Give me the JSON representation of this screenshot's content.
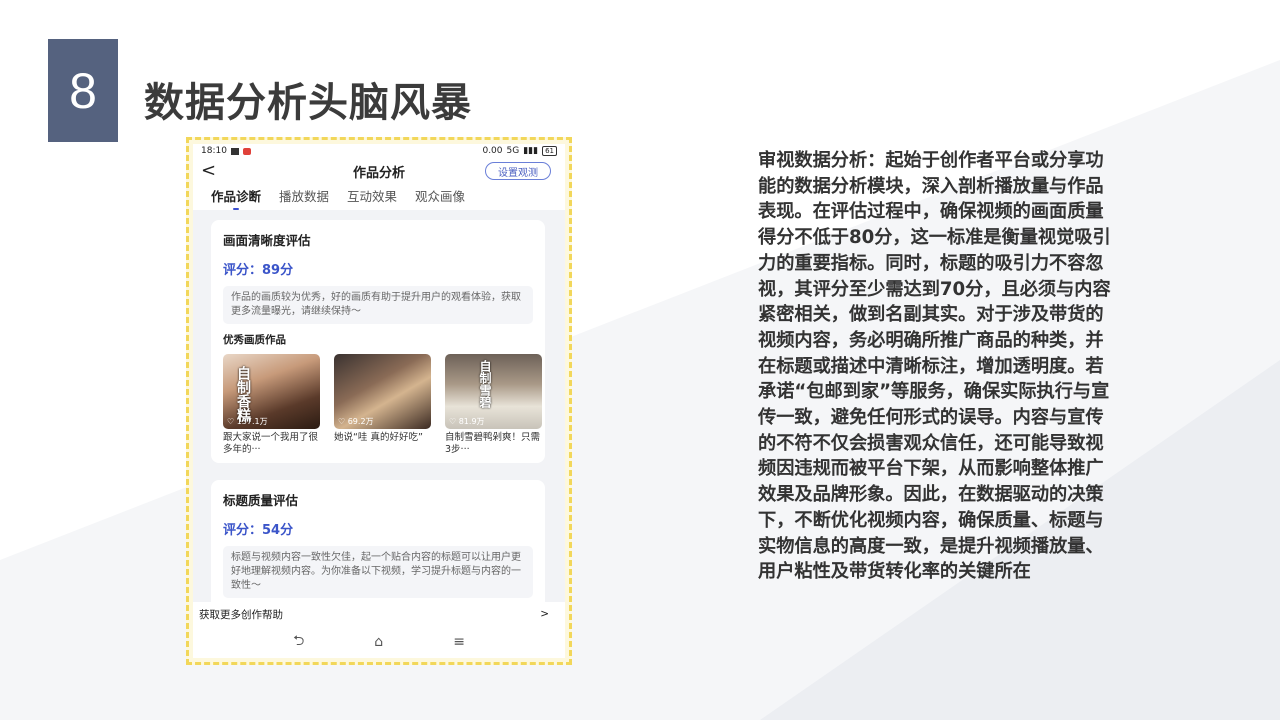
{
  "slide": {
    "number": "8",
    "title": "数据分析头脑风暴",
    "body": "审视数据分析：起始于创作者平台或分享功能的数据分析模块，深入剖析播放量与作品表现。在评估过程中，确保视频的画面质量得分不低于80分，这一标准是衡量视觉吸引力的重要指标。同时，标题的吸引力不容忽视，其评分至少需达到70分，且必须与内容紧密相关，做到名副其实。对于涉及带货的视频内容，务必明确所推广商品的种类，并在标题或描述中清晰标注，增加透明度。若承诺“包邮到家”等服务，确保实际执行与宣传一致，避免任何形式的误导。内容与宣传的不符不仅会损害观众信任，还可能导致视频因违规而被平台下架，从而影响整体推广效果及品牌形象。因此，在数据驱动的决策下，不断优化视频内容，确保质量、标题与实物信息的高度一致，是提升视频播放量、用户粘性及带货转化率的关键所在"
  },
  "phone": {
    "status": {
      "time": "18:10",
      "speed": "0.00",
      "signal": "5G",
      "battery": "61"
    },
    "nav": {
      "back": "<",
      "title": "作品分析",
      "settings_button": "设置观测"
    },
    "tabs": [
      "作品诊断",
      "播放数据",
      "互动效果",
      "观众画像"
    ],
    "quality_card": {
      "title": "画面清晰度评估",
      "score": "评分：89分",
      "desc": "作品的画质较为优秀，好的画质有助于提升用户的观看体验，获取更多流量曝光，请继续保持～",
      "section_title": "优秀画质作品",
      "items": [
        {
          "views": "♡ 137.1万",
          "caption": "跟大家说一个我用了很多年的···",
          "overlay": "自制香糕"
        },
        {
          "views": "♡ 69.2万",
          "caption": "她说“哇 真的好好吃”",
          "overlay": ""
        },
        {
          "views": "♡ 81.9万",
          "caption": "自制雪碧鸭剁爽！只需3步···",
          "overlay": "自制雪碧"
        }
      ]
    },
    "title_card": {
      "title": "标题质量评估",
      "score": "评分：54分",
      "desc": "标题与视频内容一致性欠佳，起一个贴合内容的标题可以让用户更好地理解视频内容。为你准备以下视频，学习提升标题与内容的一致性～"
    },
    "footer": {
      "label": "获取更多创作帮助",
      "arrow": ">"
    },
    "system_nav": {
      "back": "⮌",
      "home": "⌂",
      "menu": "≡"
    }
  },
  "colors": {
    "accent": "#55627f",
    "link_blue": "#3b55c9",
    "frame_yellow": "#f2d75a"
  }
}
